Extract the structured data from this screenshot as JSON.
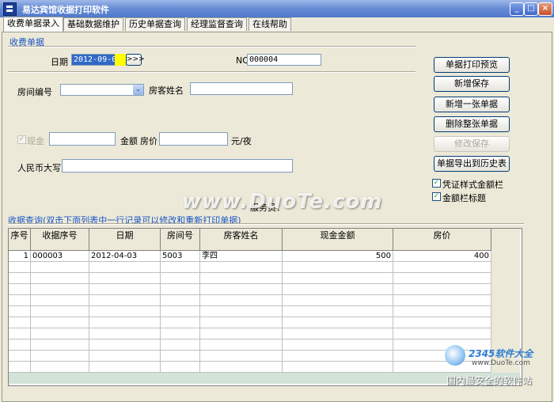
{
  "window": {
    "title": "易达宾馆收据打印软件",
    "min": "_",
    "max": "□",
    "close": "×"
  },
  "tabs": [
    "收费单据录入",
    "基础数据维护",
    "历史单据查询",
    "经理监督查询",
    "在线帮助"
  ],
  "form": {
    "group_title": "收费单据",
    "date_label": "日期",
    "date_value": "2012-09-09",
    "date_btn": ">>>",
    "no_label": "NO",
    "no_value": "000004",
    "room_label": "房间编号",
    "guest_label": "房客姓名",
    "cash_label": "现金",
    "amount_label": "金额",
    "price_label": "房价",
    "unit_label": "元/夜",
    "rmb_label": "人民币大写",
    "staff_label": "服务员："
  },
  "buttons": [
    "单据打印预览",
    "新增保存",
    "新增一张单据",
    "删除整张单据",
    "修改保存",
    "单据导出到历史表"
  ],
  "options": [
    "凭证样式金额栏",
    "金额栏标题"
  ],
  "query": {
    "title": "收据查询(双击下面列表中一行记录可以修改和重新打印单据)",
    "columns": [
      "序号",
      "收据序号",
      "日期",
      "房间号",
      "房客姓名",
      "现金金额",
      "房价"
    ],
    "rows": [
      [
        "1",
        "000003",
        "2012-04-03",
        "5003",
        "李四",
        "500",
        "400"
      ]
    ]
  },
  "watermark": "www.DuoTe.com",
  "brand": {
    "name": "2345软件大全",
    "url": "www.DuoTe.com",
    "slogan": "国内最安全的软件站"
  },
  "colors": {
    "accent": "#1a56c6",
    "titlebar": "#4f78cc",
    "date_highlight": "#ffff00"
  }
}
